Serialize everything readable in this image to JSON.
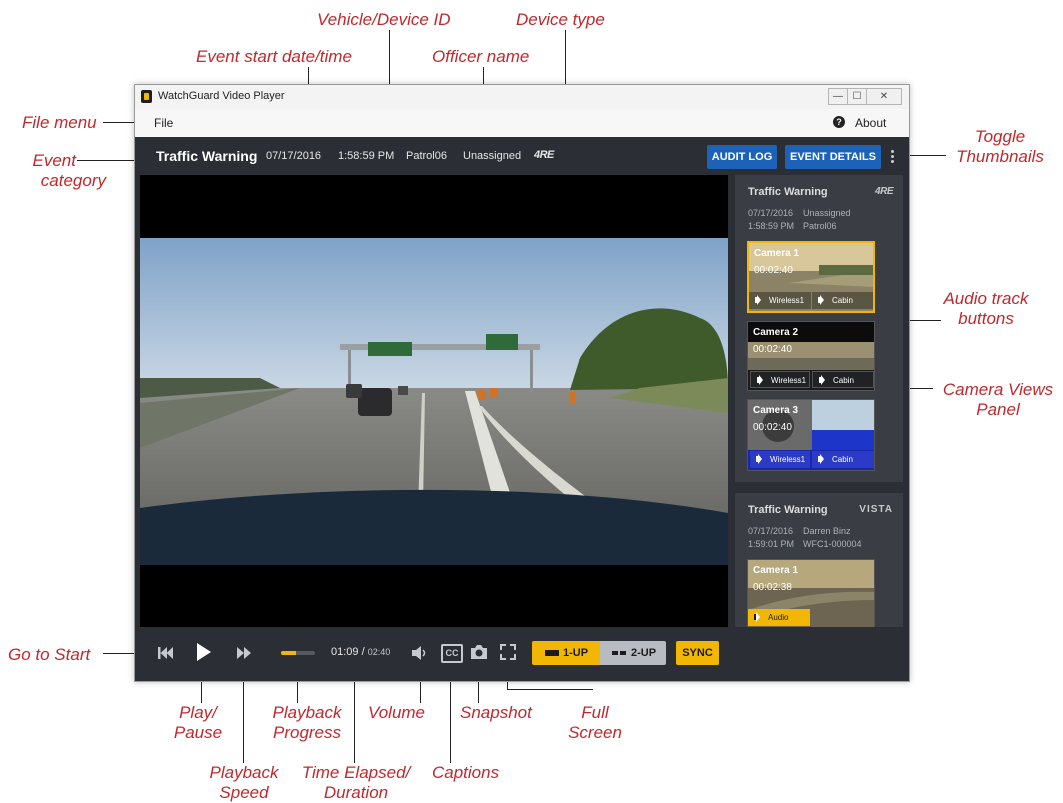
{
  "annotations": {
    "vehicle_id": "Vehicle/Device ID",
    "device_type": "Device type",
    "event_start": "Event start date/time",
    "officer_name": "Officer name",
    "file_menu": "File menu",
    "toggle_thumbnails_1": "Toggle",
    "toggle_thumbnails_2": "Thumbnails",
    "event_category_1": "Event",
    "event_category_2": "category",
    "audio_track_1": "Audio track",
    "audio_track_2": "buttons",
    "camera_views_1": "Camera Views",
    "camera_views_2": "Panel",
    "go_to_start": "Go to Start",
    "play_pause_1": "Play/",
    "play_pause_2": "Pause",
    "playback_progress_1": "Playback",
    "playback_progress_2": "Progress",
    "volume": "Volume",
    "snapshot": "Snapshot",
    "full_screen_1": "Full",
    "full_screen_2": "Screen",
    "playback_speed_1": "Playback",
    "playback_speed_2": "Speed",
    "time_elapsed_1": "Time Elapsed/",
    "time_elapsed_2": "Duration",
    "captions": "Captions"
  },
  "window": {
    "title": "WatchGuard Video Player",
    "buttons": [
      "—",
      "☐",
      "✕"
    ]
  },
  "menu": {
    "file": "File",
    "about": "About"
  },
  "header": {
    "category": "Traffic Warning",
    "date": "07/17/2016",
    "time": "1:58:59 PM",
    "vehicle": "Patrol06",
    "officer": "Unassigned",
    "device": "4RE",
    "audit_log": "AUDIT LOG",
    "event_details": "EVENT DETAILS"
  },
  "controls": {
    "progress_fraction": 0.45,
    "elapsed": "01:09",
    "separator": "/",
    "duration": "02:40",
    "cc": "CC",
    "layout_1up": "1-UP",
    "layout_2up": "2-UP",
    "sync": "SYNC"
  },
  "events": [
    {
      "category": "Traffic Warning",
      "device": "4RE",
      "date": "07/17/2016",
      "officer": "Unassigned",
      "time": "1:58:59 PM",
      "vehicle": "Patrol06",
      "cameras": [
        {
          "name": "Camera 1",
          "time": "00:02:40",
          "audio": [
            "Wireless1",
            "Cabin"
          ]
        },
        {
          "name": "Camera 2",
          "time": "00:02:40",
          "audio": [
            "Wireless1",
            "Cabin"
          ]
        },
        {
          "name": "Camera 3",
          "time": "00:02:40",
          "audio": [
            "Wireless1",
            "Cabin"
          ]
        }
      ]
    },
    {
      "category": "Traffic Warning",
      "device": "VISTA",
      "date": "07/17/2016",
      "officer": "Darren Binz",
      "time": "1:59:01 PM",
      "vehicle": "WFC1-000004",
      "cameras": [
        {
          "name": "Camera 1",
          "time": "00:02:38",
          "audio": [
            "Audio"
          ]
        }
      ]
    }
  ],
  "colors": {
    "accent": "#f2b705",
    "primary_button": "#1c63b8",
    "callout": "#c0282d",
    "dark_bg": "#2b2f35"
  }
}
